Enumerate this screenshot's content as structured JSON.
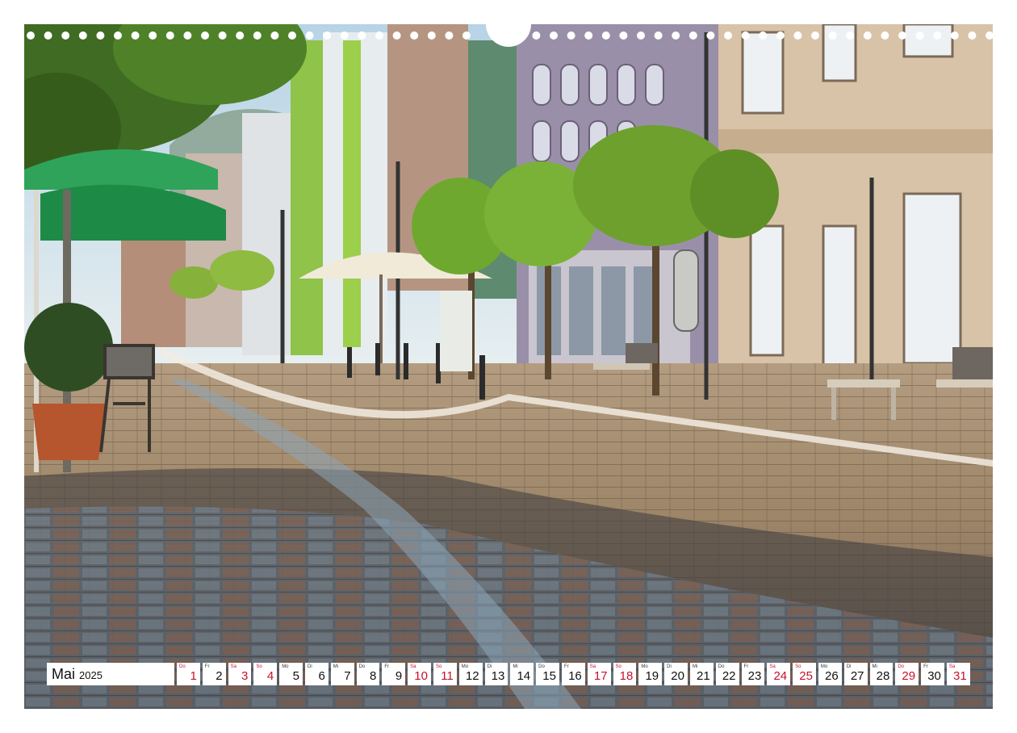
{
  "calendar": {
    "month": "Mai",
    "year": "2025",
    "days": [
      {
        "weekday": "Do",
        "day": "1",
        "red": true
      },
      {
        "weekday": "Fr",
        "day": "2",
        "red": false
      },
      {
        "weekday": "Sa",
        "day": "3",
        "red": true
      },
      {
        "weekday": "So",
        "day": "4",
        "red": true
      },
      {
        "weekday": "Mo",
        "day": "5",
        "red": false
      },
      {
        "weekday": "Di",
        "day": "6",
        "red": false
      },
      {
        "weekday": "Mi",
        "day": "7",
        "red": false
      },
      {
        "weekday": "Do",
        "day": "8",
        "red": false
      },
      {
        "weekday": "Fr",
        "day": "9",
        "red": false
      },
      {
        "weekday": "Sa",
        "day": "10",
        "red": true
      },
      {
        "weekday": "So",
        "day": "11",
        "red": true
      },
      {
        "weekday": "Mo",
        "day": "12",
        "red": false
      },
      {
        "weekday": "Di",
        "day": "13",
        "red": false
      },
      {
        "weekday": "Mi",
        "day": "14",
        "red": false
      },
      {
        "weekday": "Do",
        "day": "15",
        "red": false
      },
      {
        "weekday": "Fr",
        "day": "16",
        "red": false
      },
      {
        "weekday": "Sa",
        "day": "17",
        "red": true
      },
      {
        "weekday": "So",
        "day": "18",
        "red": true
      },
      {
        "weekday": "Mo",
        "day": "19",
        "red": false
      },
      {
        "weekday": "Di",
        "day": "20",
        "red": false
      },
      {
        "weekday": "Mi",
        "day": "21",
        "red": false
      },
      {
        "weekday": "Do",
        "day": "22",
        "red": false
      },
      {
        "weekday": "Fr",
        "day": "23",
        "red": false
      },
      {
        "weekday": "Sa",
        "day": "24",
        "red": true
      },
      {
        "weekday": "So",
        "day": "25",
        "red": true
      },
      {
        "weekday": "Mo",
        "day": "26",
        "red": false
      },
      {
        "weekday": "Di",
        "day": "27",
        "red": false
      },
      {
        "weekday": "Mi",
        "day": "28",
        "red": false
      },
      {
        "weekday": "Do",
        "day": "29",
        "red": true
      },
      {
        "weekday": "Fr",
        "day": "30",
        "red": false
      },
      {
        "weekday": "Sa",
        "day": "31",
        "red": true
      }
    ]
  },
  "colors": {
    "holiday_red": "#c8102e",
    "umbrella_green": "#1f9a4a",
    "sky": "#cfe3f0",
    "pavement": "#8a7560"
  }
}
